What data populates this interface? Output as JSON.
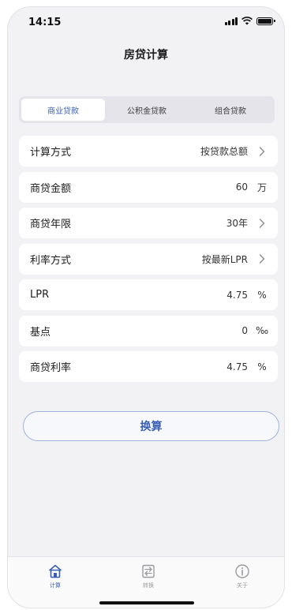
{
  "status_bar": {
    "time": "14:15"
  },
  "header": {
    "title": "房贷计算"
  },
  "segments": [
    {
      "label": "商业贷款",
      "active": true
    },
    {
      "label": "公积金贷款",
      "active": false
    },
    {
      "label": "组合贷款",
      "active": false
    }
  ],
  "rows": [
    {
      "label": "计算方式",
      "value": "按贷款总额",
      "suffix": "",
      "chevron": true
    },
    {
      "label": "商贷金额",
      "value": "60",
      "suffix": "万",
      "chevron": false
    },
    {
      "label": "商贷年限",
      "value": "30年",
      "suffix": "",
      "chevron": true
    },
    {
      "label": "利率方式",
      "value": "按最新LPR",
      "suffix": "",
      "chevron": true
    },
    {
      "label": "LPR",
      "value": "4.75",
      "suffix": "%",
      "chevron": false
    },
    {
      "label": "基点",
      "value": "0",
      "suffix": "‰",
      "chevron": false
    },
    {
      "label": "商贷利率",
      "value": "4.75",
      "suffix": "%",
      "chevron": false
    }
  ],
  "actions": {
    "convert_label": "换算"
  },
  "tabbar": {
    "items": [
      {
        "label": "计算",
        "icon": "house-icon",
        "active": true
      },
      {
        "label": "转换",
        "icon": "convert-icon",
        "active": false
      },
      {
        "label": "关于",
        "icon": "info-icon",
        "active": false
      }
    ]
  },
  "colors": {
    "accent": "#3a5fb5",
    "background": "#f2f2f5",
    "inactive": "#9b9ba0"
  }
}
